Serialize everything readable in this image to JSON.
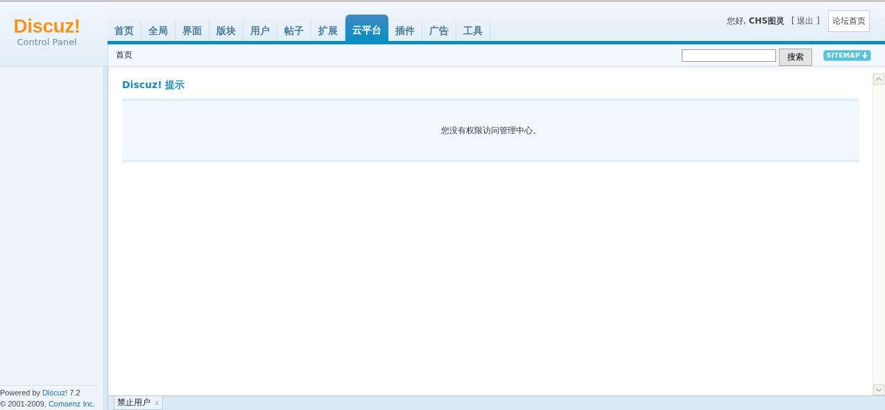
{
  "logo": {
    "name": "Discuz!",
    "subtitle": "Control Panel"
  },
  "nav": [
    {
      "label": "首页",
      "selected": false
    },
    {
      "label": "全局",
      "selected": false
    },
    {
      "label": "界面",
      "selected": false
    },
    {
      "label": "版块",
      "selected": false
    },
    {
      "label": "用户",
      "selected": false
    },
    {
      "label": "帖子",
      "selected": false
    },
    {
      "label": "扩展",
      "selected": false
    },
    {
      "label": "云平台",
      "selected": true
    },
    {
      "label": "插件",
      "selected": false
    },
    {
      "label": "广告",
      "selected": false
    },
    {
      "label": "工具",
      "selected": false
    }
  ],
  "user": {
    "greeting": "您好,",
    "name": "CHS图灵",
    "logout": "[ 退出 ]",
    "forum_home": "论坛首页"
  },
  "breadcrumb": "首页",
  "search": {
    "button": "搜索"
  },
  "sitemap": "SITEMAP",
  "notice": {
    "title": "Discuz! 提示",
    "message": "您没有权限访问管理中心。"
  },
  "footer": {
    "powered_prefix": "Powered by",
    "powered_link": "Discuz!",
    "version": "7.2",
    "copyright": "© 2001-2009,",
    "company_link": "Comsenz Inc."
  },
  "bottom_tabs": [
    {
      "label": "禁止用户",
      "close": "x"
    }
  ]
}
